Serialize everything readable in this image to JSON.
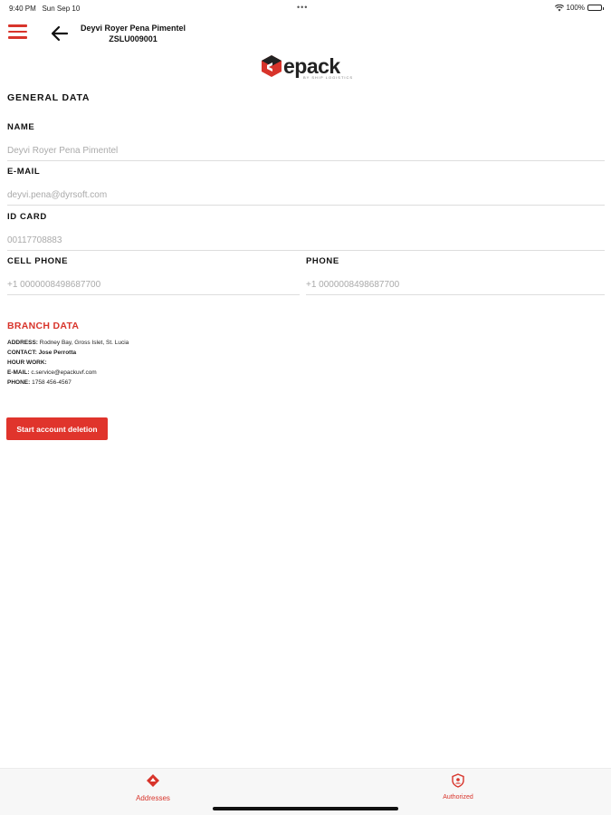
{
  "status_bar": {
    "time": "9:40 PM",
    "date": "Sun Sep 10",
    "dots": "•••",
    "battery": "100%"
  },
  "header": {
    "user_name": "Deyvi Royer Pena Pimentel",
    "account_code": "ZSLU009001"
  },
  "logo": {
    "text": "epack",
    "subtitle": "BY SHIP LOGISTICS",
    "brand_color": "#d8342b"
  },
  "general_data": {
    "title": "GENERAL DATA",
    "name_label": "NAME",
    "name_value": "Deyvi Royer Pena Pimentel",
    "email_label": "E-MAIL",
    "email_value": "deyvi.pena@dyrsoft.com",
    "id_label": "ID CARD",
    "id_value": "00117708883",
    "cell_label": "CELL PHONE",
    "cell_value": "+1 0000008498687700",
    "phone_label": "PHONE",
    "phone_value": "+1 0000008498687700"
  },
  "branch_data": {
    "title": "BRANCH DATA",
    "address_label": "ADDRESS:",
    "address_value": "Rodney Bay, Gross Islet, St. Lucia",
    "contact_label": "CONTACT:",
    "contact_value": "Jose Perrotta",
    "hours_label": "HOUR WORK:",
    "hours_value": "",
    "email_label": "E-MAIL:",
    "email_value": "c.service@epackuvf.com",
    "phone_label": "PHONE:",
    "phone_value": "1758 456-4567"
  },
  "actions": {
    "delete_label": "Start account deletion",
    "delete_color": "#e0342c"
  },
  "tabs": [
    {
      "label": "Addresses",
      "icon": "location-diamond-icon"
    },
    {
      "label": "Authorized",
      "icon": "shield-user-icon"
    }
  ]
}
